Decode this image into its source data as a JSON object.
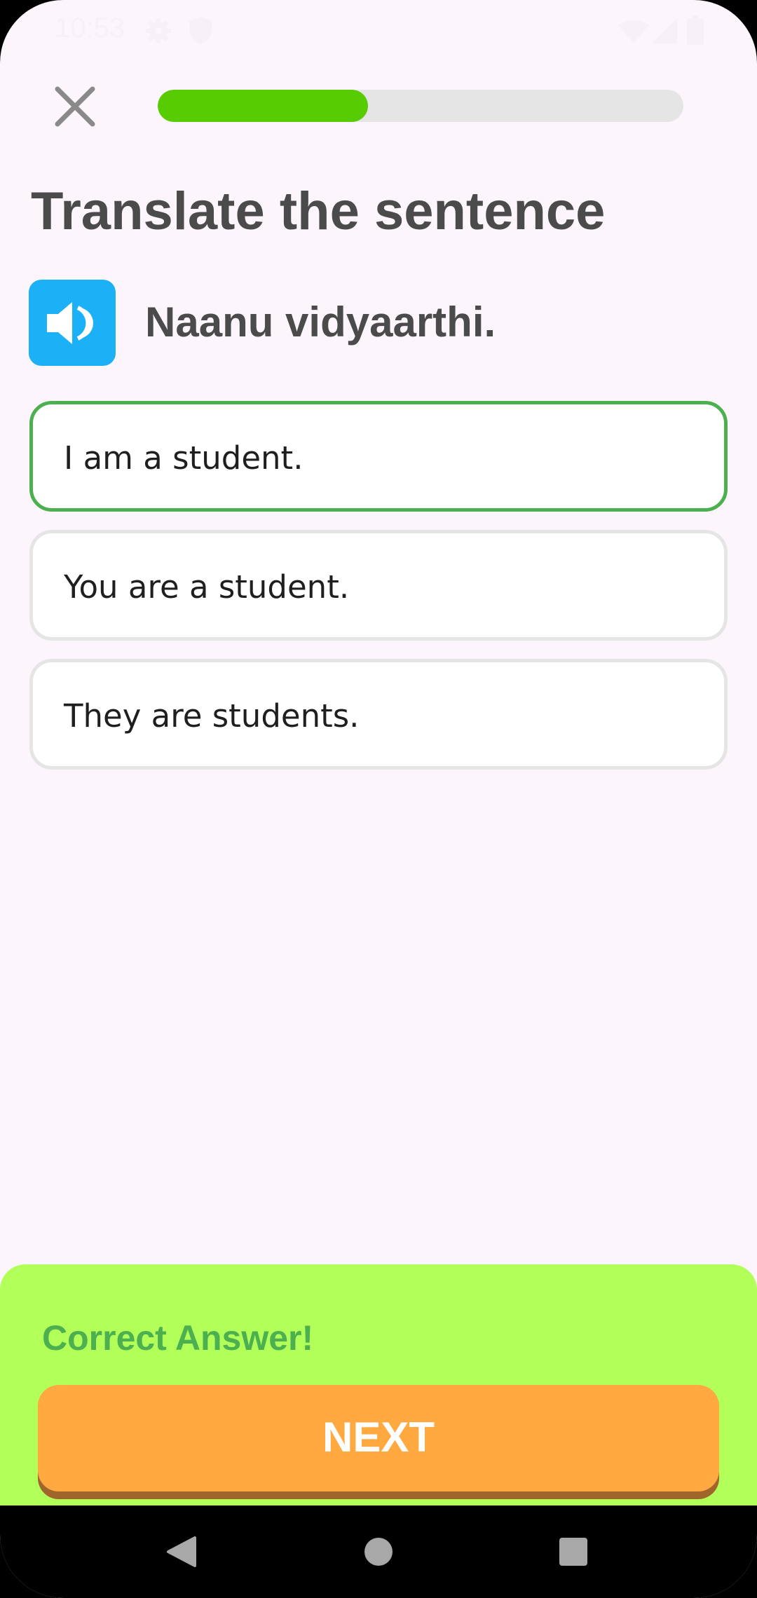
{
  "status_bar": {
    "time": "10:53",
    "icons": [
      "settings-icon",
      "shield-icon",
      "wifi-icon",
      "cell-signal-icon",
      "battery-icon"
    ]
  },
  "top_bar": {
    "close_icon": "close-icon",
    "progress": 0.4
  },
  "exercise": {
    "title": "Translate the sentence",
    "audio_icon": "speaker-icon",
    "prompt": "Naanu vidyaarthi.",
    "options": [
      {
        "label": "I am a student.",
        "selected": true
      },
      {
        "label": "You are a student.",
        "selected": false
      },
      {
        "label": "They are students.",
        "selected": false
      }
    ]
  },
  "feedback": {
    "message": "Correct Answer!",
    "next_label": "NEXT"
  },
  "nav_bar": {
    "icons": [
      "back-icon",
      "home-icon",
      "recents-icon"
    ]
  },
  "colors": {
    "background": "#fcf5fc",
    "progress_fill": "#58cc02",
    "speaker": "#1cb0f6",
    "selected_border": "#4caf50",
    "feedback_bg": "#b2ff59",
    "feedback_text": "#4caf50",
    "next_button": "#ffa940"
  }
}
